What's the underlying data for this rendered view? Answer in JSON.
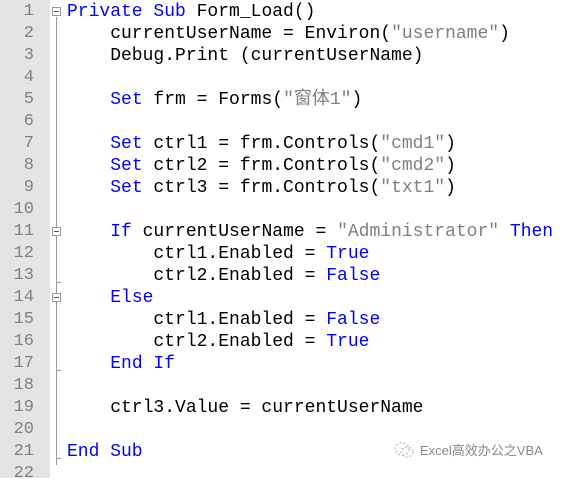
{
  "line_numbers": [
    "1",
    "2",
    "3",
    "4",
    "5",
    "6",
    "7",
    "8",
    "9",
    "10",
    "11",
    "12",
    "13",
    "14",
    "15",
    "16",
    "17",
    "18",
    "19",
    "20",
    "21",
    "22"
  ],
  "lines": [
    [
      [
        "kw",
        "Private Sub"
      ],
      [
        "t",
        " Form_Load()"
      ]
    ],
    [
      [
        "t",
        "    currentUserName = Environ("
      ],
      [
        "str",
        "\"username\""
      ],
      [
        "t",
        ")"
      ]
    ],
    [
      [
        "t",
        "    Debug.Print (currentUserName)"
      ]
    ],
    [],
    [
      [
        "t",
        "    "
      ],
      [
        "kw",
        "Set"
      ],
      [
        "t",
        " frm = Forms("
      ],
      [
        "str",
        "\"窗体1\""
      ],
      [
        "t",
        ")"
      ]
    ],
    [],
    [
      [
        "t",
        "    "
      ],
      [
        "kw",
        "Set"
      ],
      [
        "t",
        " ctrl1 = frm.Controls("
      ],
      [
        "str",
        "\"cmd1\""
      ],
      [
        "t",
        ")"
      ]
    ],
    [
      [
        "t",
        "    "
      ],
      [
        "kw",
        "Set"
      ],
      [
        "t",
        " ctrl2 = frm.Controls("
      ],
      [
        "str",
        "\"cmd2\""
      ],
      [
        "t",
        ")"
      ]
    ],
    [
      [
        "t",
        "    "
      ],
      [
        "kw",
        "Set"
      ],
      [
        "t",
        " ctrl3 = frm.Controls("
      ],
      [
        "str",
        "\"txt1\""
      ],
      [
        "t",
        ")"
      ]
    ],
    [],
    [
      [
        "t",
        "    "
      ],
      [
        "kw",
        "If"
      ],
      [
        "t",
        " currentUserName = "
      ],
      [
        "str",
        "\"Administrator\""
      ],
      [
        "t",
        " "
      ],
      [
        "kw",
        "Then"
      ]
    ],
    [
      [
        "t",
        "        ctrl1.Enabled = "
      ],
      [
        "kw",
        "True"
      ]
    ],
    [
      [
        "t",
        "        ctrl2.Enabled = "
      ],
      [
        "kw",
        "False"
      ]
    ],
    [
      [
        "t",
        "    "
      ],
      [
        "kw",
        "Else"
      ]
    ],
    [
      [
        "t",
        "        ctrl1.Enabled = "
      ],
      [
        "kw",
        "False"
      ]
    ],
    [
      [
        "t",
        "        ctrl2.Enabled = "
      ],
      [
        "kw",
        "True"
      ]
    ],
    [
      [
        "t",
        "    "
      ],
      [
        "kw",
        "End If"
      ]
    ],
    [],
    [
      [
        "t",
        "    ctrl3.Value = currentUserName"
      ]
    ],
    [],
    [
      [
        "kw",
        "End Sub"
      ]
    ],
    []
  ],
  "watermark": "Excel高效办公之VBA"
}
